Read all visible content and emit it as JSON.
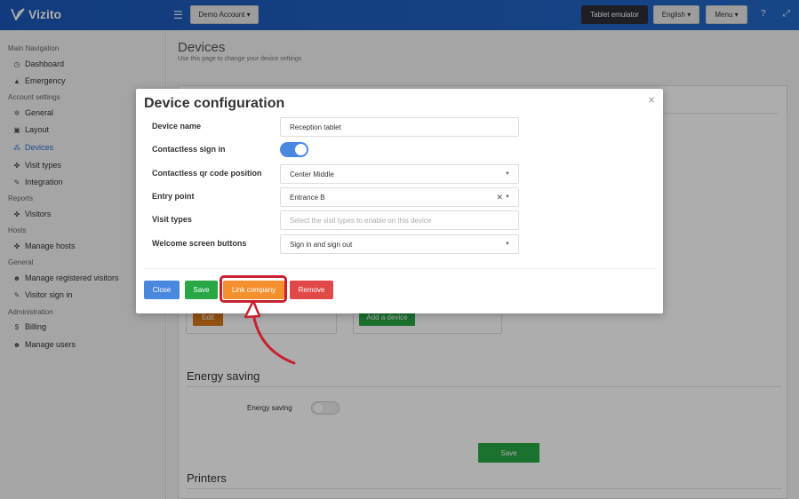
{
  "topbar": {
    "logo_text": "Vizito",
    "account_button": "Demo Account ▾",
    "tablet_emulator": "Tablet emulator",
    "language_button": "English ▾",
    "menu_button": "Menu ▾",
    "help_icon": "?",
    "expand_icon": "⤢"
  },
  "sidebar": {
    "sections": [
      {
        "heading": "Main Navigation",
        "items": [
          {
            "label": "Dashboard",
            "icon": "◷"
          },
          {
            "label": "Emergency",
            "icon": "▲"
          }
        ]
      },
      {
        "heading": "Account settings",
        "items": [
          {
            "label": "General",
            "icon": "✲"
          },
          {
            "label": "Layout",
            "icon": "▣"
          },
          {
            "label": "Devices",
            "icon": "⁂"
          },
          {
            "label": "Visit types",
            "icon": "✤"
          },
          {
            "label": "Integration",
            "icon": "✎"
          }
        ]
      },
      {
        "heading": "Reports",
        "items": [
          {
            "label": "Visitors",
            "icon": "✤"
          }
        ]
      },
      {
        "heading": "Hosts",
        "items": [
          {
            "label": "Manage hosts",
            "icon": "✤"
          }
        ]
      },
      {
        "heading": "General",
        "items": [
          {
            "label": "Manage registered visitors",
            "icon": "☻"
          },
          {
            "label": "Visitor sign in",
            "icon": "✎"
          }
        ]
      },
      {
        "heading": "Administration",
        "items": [
          {
            "label": "Billing",
            "icon": "$"
          },
          {
            "label": "Manage users",
            "icon": "☻"
          }
        ]
      }
    ]
  },
  "main": {
    "title": "Devices",
    "subtitle": "Use this page to change your device settings",
    "edit_button": "Edit",
    "add_device_button": "Add a device",
    "energy_section_title": "Energy saving",
    "energy_label": "Energy saving",
    "save_button": "Save",
    "printers_title": "Printers"
  },
  "modal": {
    "title": "Device configuration",
    "close_icon": "×",
    "fields": {
      "device_name": {
        "label": "Device name",
        "value": "Reception tablet"
      },
      "contactless": {
        "label": "Contactless sign in"
      },
      "qr_position": {
        "label": "Contactless qr code position",
        "value": "Center Middle"
      },
      "entry_point": {
        "label": "Entry point",
        "value": "Entrance B"
      },
      "visit_types": {
        "label": "Visit types",
        "placeholder": "Select the visit types to enable on this device"
      },
      "welcome_buttons": {
        "label": "Welcome screen buttons",
        "value": "Sign in and sign out"
      }
    },
    "buttons": {
      "close": "Close",
      "save": "Save",
      "link_company": "Link company",
      "remove": "Remove"
    }
  },
  "colors": {
    "topbar": "#1a58b9",
    "primary": "#4a87df",
    "success": "#27a844",
    "warning": "#f4902e",
    "danger": "#e14848",
    "highlight": "#c8202f"
  }
}
